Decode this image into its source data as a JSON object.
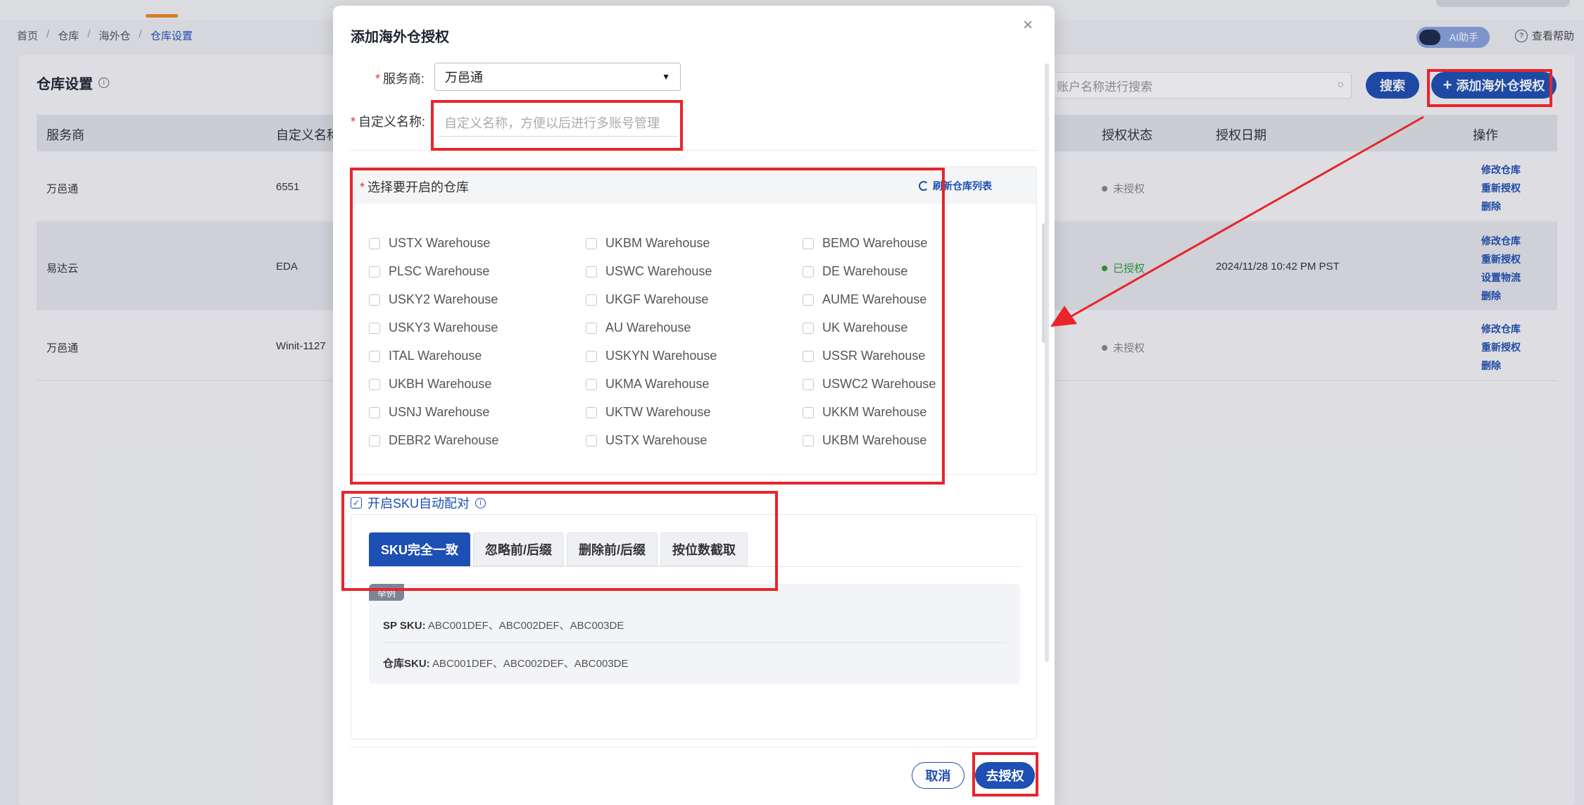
{
  "topbar": {},
  "breadcrumb": {
    "items": [
      "首页",
      "仓库",
      "海外仓"
    ],
    "current": "仓库设置"
  },
  "header": {
    "ai_label": "AI助手",
    "help_label": "查看帮助"
  },
  "page": {
    "title": "仓库设置"
  },
  "search": {
    "placeholder": "账户名称进行搜索",
    "button": "搜索"
  },
  "add_button": "添加海外仓授权",
  "table": {
    "columns": {
      "provider": "服务商",
      "custom_name": "自定义名称",
      "auth_status": "授权状态",
      "auth_date": "授权日期",
      "ops": "操作"
    },
    "rows": [
      {
        "provider": "万邑通",
        "custom_name": "6551",
        "status": "未授权",
        "date": "",
        "ops": [
          "修改仓库",
          "重新授权",
          "删除"
        ]
      },
      {
        "provider": "易达云",
        "custom_name": "EDA",
        "status": "已授权",
        "date": "2024/11/28 10:42 PM PST",
        "ops": [
          "修改仓库",
          "重新授权",
          "设置物流",
          "删除"
        ]
      },
      {
        "provider": "万邑通",
        "custom_name": "Winit-1127",
        "status": "未授权",
        "date": "",
        "ops": [
          "修改仓库",
          "重新授权",
          "删除"
        ]
      }
    ]
  },
  "modal": {
    "title": "添加海外仓授权",
    "required_mark": "*",
    "provider_label": "服务商:",
    "provider_value": "万邑通",
    "name_label": "自定义名称:",
    "name_placeholder": "自定义名称，方便以后进行多账号管理",
    "warehouse_label": "选择要开启的仓库",
    "refresh_label": "刷新仓库列表",
    "warehouses": [
      "USTX Warehouse",
      "UKBM Warehouse",
      "BEMO Warehouse",
      "PLSC Warehouse",
      "USWC Warehouse",
      "DE Warehouse",
      "USKY2 Warehouse",
      "UKGF Warehouse",
      "AUME Warehouse",
      "USKY3 Warehouse",
      "AU Warehouse",
      "UK Warehouse",
      "ITAL Warehouse",
      "USKYN Warehouse",
      "USSR Warehouse",
      "UKBH Warehouse",
      "UKMA Warehouse",
      "USWC2 Warehouse",
      "USNJ Warehouse",
      "UKTW Warehouse",
      "UKKM Warehouse",
      "DEBR2 Warehouse",
      "USTX Warehouse",
      "UKBM Warehouse"
    ],
    "sku_toggle_label": "开启SKU自动配对",
    "tabs": [
      "SKU完全一致",
      "忽略前/后缀",
      "删除前/后缀",
      "按位数截取"
    ],
    "example_badge": "举例",
    "example_sp": {
      "label": "SP SKU:",
      "value": "ABC001DEF、ABC002DEF、ABC003DE"
    },
    "example_wh": {
      "label": "仓库SKU:",
      "value": "ABC001DEF、ABC002DEF、ABC003DE"
    },
    "cancel": "取消",
    "confirm": "去授权"
  },
  "colors": {
    "primary": "#1d4fb4",
    "annotation": "#e8252a",
    "success": "#2b9c3a"
  }
}
